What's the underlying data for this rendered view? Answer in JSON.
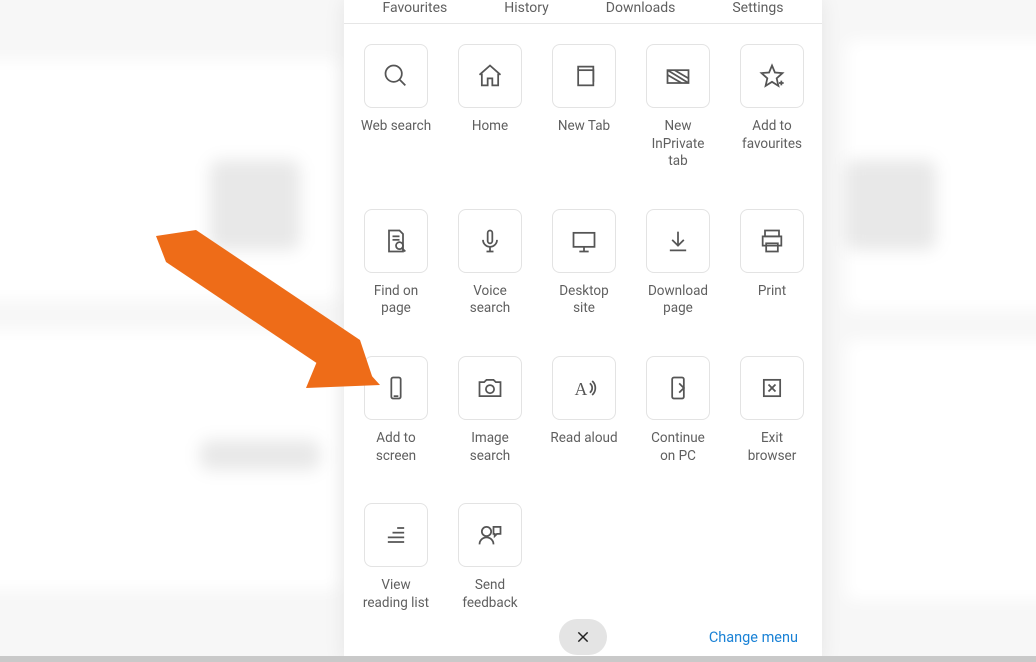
{
  "topnav": {
    "favourites": "Favourites",
    "history": "History",
    "downloads": "Downloads",
    "settings": "Settings"
  },
  "tiles": {
    "websearch": "Web search",
    "home": "Home",
    "newtab": "New Tab",
    "newinprivate": "New\nInPrivate\ntab",
    "addfav": "Add to\nfavourites",
    "findonpage": "Find on\npage",
    "voicesearch": "Voice\nsearch",
    "desktopsite": "Desktop\nsite",
    "downloadpage": "Download\npage",
    "print": "Print",
    "addtoscreen": "Add to\nscreen",
    "imagesearch": "Image\nsearch",
    "readaloud": "Read aloud",
    "continuepc": "Continue\non PC",
    "exitbrowser": "Exit\nbrowser",
    "viewreading": "View\nreading list",
    "sendfeedback": "Send\nfeedback"
  },
  "bottom": {
    "change_menu": "Change menu"
  },
  "colors": {
    "arrow": "#ee6c18",
    "link": "#1a82d6"
  }
}
